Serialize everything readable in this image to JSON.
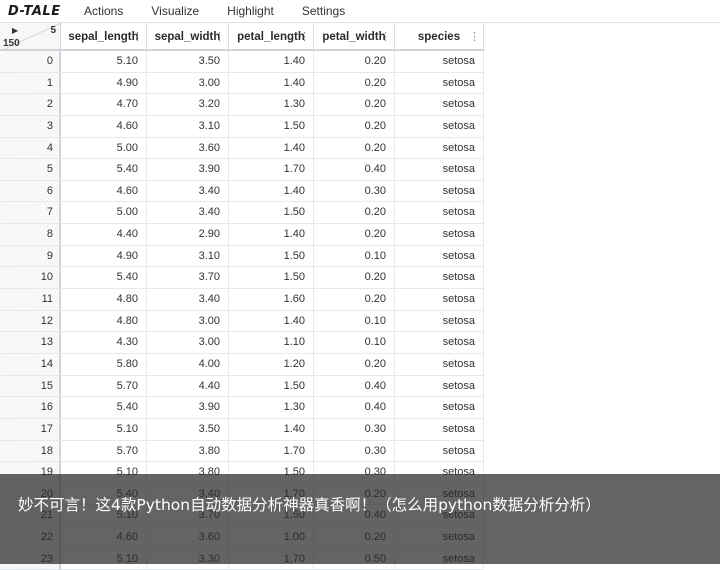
{
  "app": {
    "logo": "D-TALE"
  },
  "menu": [
    "Actions",
    "Visualize",
    "Highlight",
    "Settings"
  ],
  "grid": {
    "col_count": "5",
    "row_count": "150",
    "columns": [
      "sepal_length",
      "sepal_width",
      "petal_length",
      "petal_width",
      "species"
    ],
    "rows": [
      {
        "i": "0",
        "v": [
          "5.10",
          "3.50",
          "1.40",
          "0.20",
          "setosa"
        ]
      },
      {
        "i": "1",
        "v": [
          "4.90",
          "3.00",
          "1.40",
          "0.20",
          "setosa"
        ]
      },
      {
        "i": "2",
        "v": [
          "4.70",
          "3.20",
          "1.30",
          "0.20",
          "setosa"
        ]
      },
      {
        "i": "3",
        "v": [
          "4.60",
          "3.10",
          "1.50",
          "0.20",
          "setosa"
        ]
      },
      {
        "i": "4",
        "v": [
          "5.00",
          "3.60",
          "1.40",
          "0.20",
          "setosa"
        ]
      },
      {
        "i": "5",
        "v": [
          "5.40",
          "3.90",
          "1.70",
          "0.40",
          "setosa"
        ]
      },
      {
        "i": "6",
        "v": [
          "4.60",
          "3.40",
          "1.40",
          "0.30",
          "setosa"
        ]
      },
      {
        "i": "7",
        "v": [
          "5.00",
          "3.40",
          "1.50",
          "0.20",
          "setosa"
        ]
      },
      {
        "i": "8",
        "v": [
          "4.40",
          "2.90",
          "1.40",
          "0.20",
          "setosa"
        ]
      },
      {
        "i": "9",
        "v": [
          "4.90",
          "3.10",
          "1.50",
          "0.10",
          "setosa"
        ]
      },
      {
        "i": "10",
        "v": [
          "5.40",
          "3.70",
          "1.50",
          "0.20",
          "setosa"
        ]
      },
      {
        "i": "11",
        "v": [
          "4.80",
          "3.40",
          "1.60",
          "0.20",
          "setosa"
        ]
      },
      {
        "i": "12",
        "v": [
          "4.80",
          "3.00",
          "1.40",
          "0.10",
          "setosa"
        ]
      },
      {
        "i": "13",
        "v": [
          "4.30",
          "3.00",
          "1.10",
          "0.10",
          "setosa"
        ]
      },
      {
        "i": "14",
        "v": [
          "5.80",
          "4.00",
          "1.20",
          "0.20",
          "setosa"
        ]
      },
      {
        "i": "15",
        "v": [
          "5.70",
          "4.40",
          "1.50",
          "0.40",
          "setosa"
        ]
      },
      {
        "i": "16",
        "v": [
          "5.40",
          "3.90",
          "1.30",
          "0.40",
          "setosa"
        ]
      },
      {
        "i": "17",
        "v": [
          "5.10",
          "3.50",
          "1.40",
          "0.30",
          "setosa"
        ]
      },
      {
        "i": "18",
        "v": [
          "5.70",
          "3.80",
          "1.70",
          "0.30",
          "setosa"
        ]
      },
      {
        "i": "19",
        "v": [
          "5.10",
          "3.80",
          "1.50",
          "0.30",
          "setosa"
        ]
      },
      {
        "i": "20",
        "v": [
          "5.40",
          "3.40",
          "1.70",
          "0.20",
          "setosa"
        ]
      },
      {
        "i": "21",
        "v": [
          "5.10",
          "3.70",
          "1.50",
          "0.40",
          "setosa"
        ]
      },
      {
        "i": "22",
        "v": [
          "4.60",
          "3.60",
          "1.00",
          "0.20",
          "setosa"
        ]
      },
      {
        "i": "23",
        "v": [
          "5.10",
          "3.30",
          "1.70",
          "0.50",
          "setosa"
        ]
      }
    ]
  },
  "caption": "妙不可言！这4款Python自动数据分析神器真香啊！（怎么用python数据分析分析）"
}
